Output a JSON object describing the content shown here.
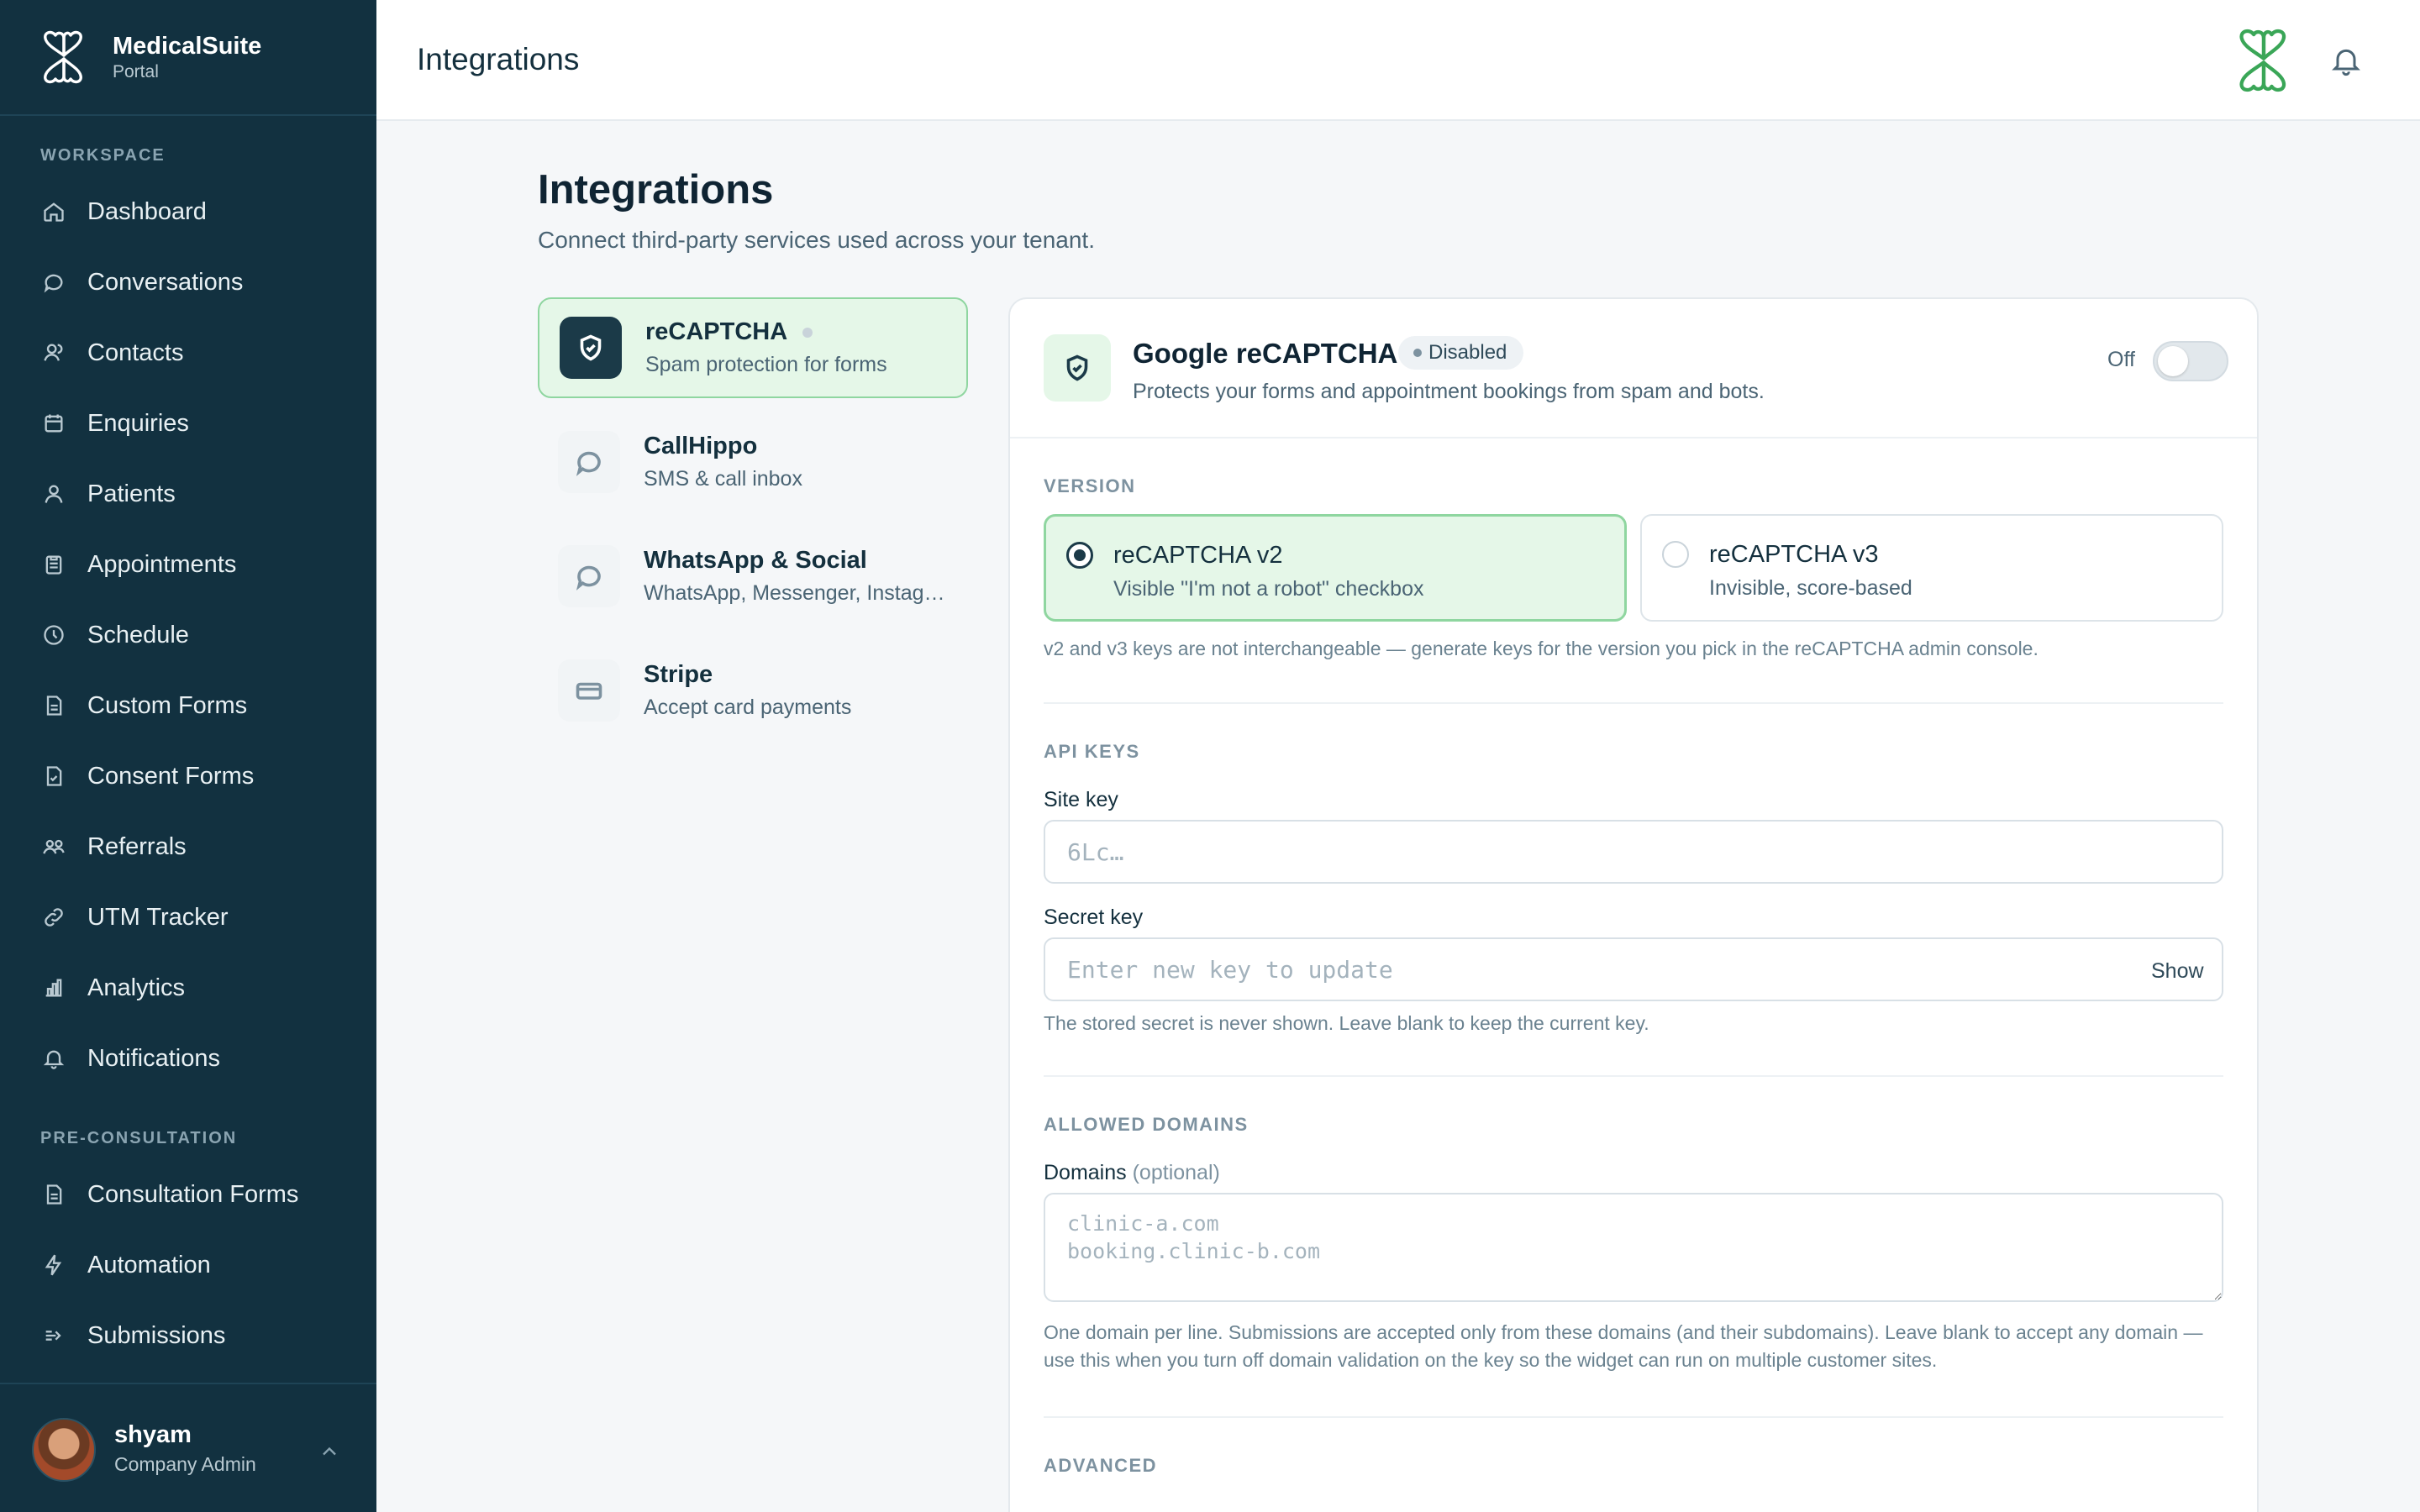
{
  "brand": {
    "name": "MedicalSuite",
    "subtitle": "Portal"
  },
  "sidebar": {
    "sections": [
      {
        "label": "WORKSPACE"
      },
      {
        "label": "PRE-CONSULTATION"
      }
    ],
    "items": [
      {
        "label": "Dashboard",
        "icon": "home-icon"
      },
      {
        "label": "Conversations",
        "icon": "chat-icon"
      },
      {
        "label": "Contacts",
        "icon": "contacts-icon"
      },
      {
        "label": "Enquiries",
        "icon": "calendar-icon"
      },
      {
        "label": "Patients",
        "icon": "user-icon"
      },
      {
        "label": "Appointments",
        "icon": "clipboard-icon"
      },
      {
        "label": "Schedule",
        "icon": "clock-icon"
      },
      {
        "label": "Custom Forms",
        "icon": "document-icon"
      },
      {
        "label": "Consent Forms",
        "icon": "document-check-icon"
      },
      {
        "label": "Referrals",
        "icon": "referrals-icon"
      },
      {
        "label": "UTM Tracker",
        "icon": "link-icon"
      },
      {
        "label": "Analytics",
        "icon": "bar-chart-icon"
      },
      {
        "label": "Notifications",
        "icon": "bell-icon"
      },
      {
        "label": "Consultation Forms",
        "icon": "document-icon"
      },
      {
        "label": "Automation",
        "icon": "lightning-icon"
      },
      {
        "label": "Submissions",
        "icon": "arrow-in-icon"
      }
    ]
  },
  "user": {
    "name": "shyam",
    "role": "Company Admin"
  },
  "topbar": {
    "title": "Integrations"
  },
  "page": {
    "title": "Integrations",
    "subtitle": "Connect third-party services used across your tenant."
  },
  "integrations": [
    {
      "name": "reCAPTCHA",
      "desc": "Spam protection for forms",
      "icon": "shield-check-icon",
      "active": true
    },
    {
      "name": "CallHippo",
      "desc": "SMS & call inbox",
      "icon": "chat-icon"
    },
    {
      "name": "WhatsApp & Social",
      "desc": "WhatsApp, Messenger, Instagram",
      "icon": "chat-icon"
    },
    {
      "name": "Stripe",
      "desc": "Accept card payments",
      "icon": "credit-card-icon"
    }
  ],
  "card": {
    "title": "Google reCAPTCHA",
    "status": "Disabled",
    "desc": "Protects your forms and appointment bookings from spam and bots.",
    "toggle_label": "Off",
    "toggle_on": false,
    "version": {
      "label": "VERSION",
      "options": [
        {
          "name": "reCAPTCHA v2",
          "desc": "Visible \"I'm not a robot\" checkbox",
          "selected": true
        },
        {
          "name": "reCAPTCHA v3",
          "desc": "Invisible, score-based",
          "selected": false
        }
      ],
      "hint": "v2 and v3 keys are not interchangeable — generate keys for the version you pick in the reCAPTCHA admin console."
    },
    "api_keys": {
      "label": "API KEYS",
      "site_key_label": "Site key",
      "site_key_placeholder": "6Lc…",
      "secret_key_label": "Secret key",
      "secret_key_placeholder": "Enter new key to update",
      "show_label": "Show",
      "hint": "The stored secret is never shown. Leave blank to keep the current key."
    },
    "domains": {
      "label": "ALLOWED DOMAINS",
      "field_label": "Domains",
      "optional": "(optional)",
      "placeholder": "clinic-a.com\nbooking.clinic-b.com",
      "hint": "One domain per line. Submissions are accepted only from these domains (and their subdomains). Leave blank to accept any domain — use this when you turn off domain validation on the key so the widget can run on multiple customer sites."
    },
    "advanced_label": "ADVANCED"
  },
  "colors": {
    "sidebar": "#123140",
    "accent_green": "#8fd6a0",
    "accent_bg": "#e5f7e8",
    "logo_green": "#3aa657"
  }
}
